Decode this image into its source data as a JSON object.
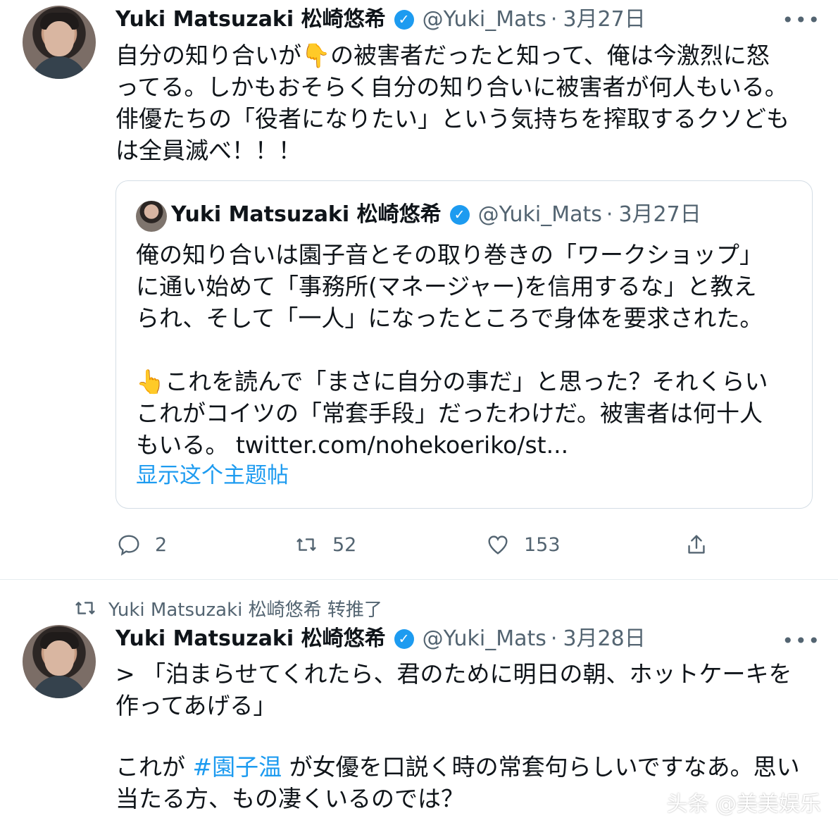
{
  "tweet1": {
    "name": "Yuki Matsuzaki 松崎悠希",
    "handle": "@Yuki_Mats",
    "date": "3月27日",
    "more": "•••",
    "lines": [
      "自分の知り合いが👇の被害者だったと知って、俺は今激烈に怒",
      "ってる。しかもおそらく自分の知り合いに被害者が何人もいる。",
      "俳優たちの「役者になりたい」という気持ちを搾取するクソども",
      "は全員滅べ！！！"
    ],
    "quote": {
      "name": "Yuki Matsuzaki 松崎悠希",
      "handle": "@Yuki_Mats",
      "date": "3月27日",
      "lines": [
        "俺の知り合いは園子音とその取り巻きの「ワークショップ」",
        "に通い始めて「事務所(マネージャー)を信用するな」と教え",
        "られ、そして「一人」になったところで身体を要求された。",
        "",
        "👆これを読んで「まさに自分の事だ」と思った？それくらい",
        "これがコイツの「常套手段」だったわけだ。被害者は何十人",
        "もいる。 twitter.com/nohekoeriko/st..."
      ],
      "show_thread": "显示这个主题帖"
    },
    "actions": {
      "reply_count": "2",
      "retweet_count": "52",
      "like_count": "153"
    }
  },
  "tweet2": {
    "retweeted_by": "Yuki Matsuzaki 松崎悠希 转推了",
    "name": "Yuki Matsuzaki 松崎悠希",
    "handle": "@Yuki_Mats",
    "date": "3月28日",
    "more": "•••",
    "line1": "> 「泊まらせてくれたら、君のために明日の朝、ホットケーキを",
    "line2": "作ってあげる」",
    "line3_prefix": "これが ",
    "hashtag": "#園子温",
    "line3_suffix": " が女優を口説く時の常套句らしいですなあ。思い",
    "line4": "当たる方、もの凄くいるのでは？"
  },
  "watermark": "头条 @美美娱乐",
  "colors": {
    "accent": "#1d9bf0",
    "muted": "#536471",
    "text": "#0f1419"
  }
}
